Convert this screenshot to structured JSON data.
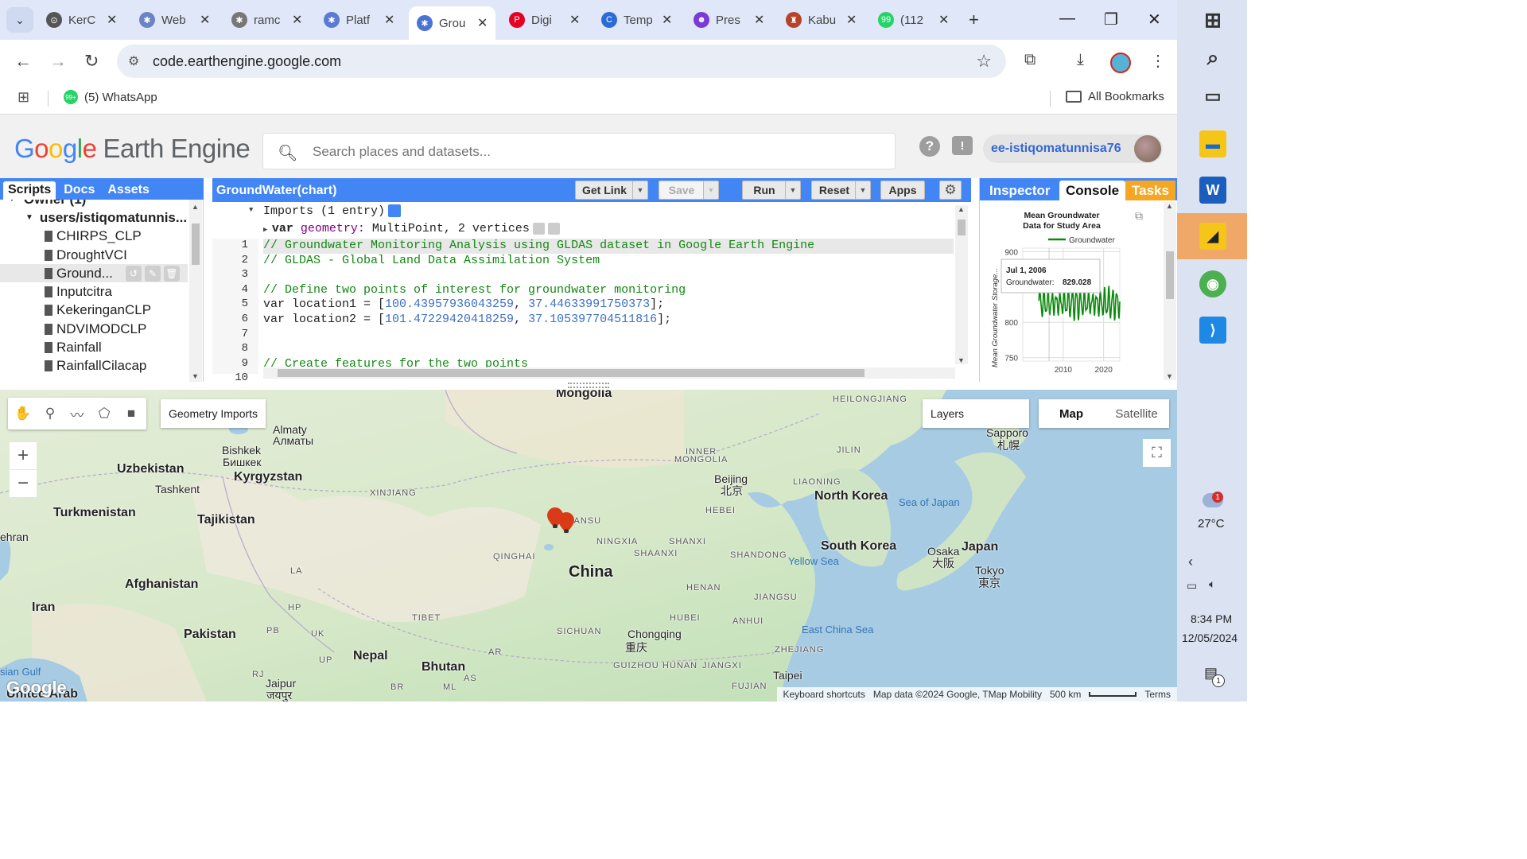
{
  "browser": {
    "tabs": [
      {
        "title": "KerC",
        "color": "#555555",
        "glyph": "⊙"
      },
      {
        "title": "Web",
        "color": "#6a84c4",
        "glyph": "✱"
      },
      {
        "title": "ramc",
        "color": "#777777",
        "glyph": "✱"
      },
      {
        "title": "Platf",
        "color": "#5a7bd4",
        "glyph": "✱"
      },
      {
        "title": "Grou",
        "color": "#4a74d4",
        "glyph": "✱",
        "active": true
      },
      {
        "title": "Digi",
        "color": "#e60023",
        "glyph": "P"
      },
      {
        "title": "Temp",
        "color": "#2a6bd6",
        "glyph": "C"
      },
      {
        "title": "Pres",
        "color": "#7a3ad6",
        "glyph": "☻"
      },
      {
        "title": "Kabu",
        "color": "#b5432a",
        "glyph": "♜"
      },
      {
        "title": "(112",
        "color": "#25d366",
        "glyph": "99"
      }
    ],
    "url": "code.earthengine.google.com",
    "bookmarks": {
      "whatsapp": "(5) WhatsApp",
      "whatsapp_badge": "99+",
      "all": "All Bookmarks"
    }
  },
  "gee": {
    "logo_google": [
      "G",
      "o",
      "o",
      "g",
      "l",
      "e"
    ],
    "logo_product": "Earth Engine",
    "search_placeholder": "Search places and datasets...",
    "username": "ee-istiqomatunnisa76",
    "left_tabs": [
      "Scripts",
      "Docs",
      "Assets"
    ],
    "tree": {
      "owner": "Owner (1)",
      "repo": "users/istiqomatunnis...",
      "files": [
        "CHIRPS_CLP",
        "DroughtVCI",
        "Ground...",
        "Inputcitra",
        "KekeringanCLP",
        "NDVIMODCLP",
        "Rainfall",
        "RainfallCilacap"
      ]
    },
    "editor": {
      "title": "GroundWater(chart)",
      "buttons": {
        "get_link": "Get Link",
        "save": "Save",
        "run": "Run",
        "reset": "Reset",
        "apps": "Apps"
      },
      "imports_header": "Imports (1 entry)",
      "imports_var_kw": "var",
      "imports_var_name": "geometry:",
      "imports_var_value": "MultiPoint, 2 vertices",
      "line_numbers": [
        "1",
        "2",
        "3",
        "4",
        "5",
        "6",
        "7",
        "8",
        "9",
        "10"
      ],
      "lines": [
        {
          "parts": [
            {
              "t": "// Groundwater Monitoring Analysis using GLDAS dataset in Google Earth Engine",
              "c": "cm"
            }
          ]
        },
        {
          "parts": [
            {
              "t": "// GLDAS - Global Land Data Assimilation System",
              "c": "cm"
            }
          ]
        },
        {
          "parts": [
            {
              "t": "",
              "c": ""
            }
          ]
        },
        {
          "parts": [
            {
              "t": "// Define two points of interest for groundwater monitoring",
              "c": "cm"
            }
          ]
        },
        {
          "parts": [
            {
              "t": "var location1 = [",
              "c": ""
            },
            {
              "t": "100.43957936043259",
              "c": "num"
            },
            {
              "t": ", ",
              "c": ""
            },
            {
              "t": "37.44633991750373",
              "c": "num"
            },
            {
              "t": "];",
              "c": ""
            }
          ]
        },
        {
          "parts": [
            {
              "t": "var location2 = [",
              "c": ""
            },
            {
              "t": "101.47229420418259",
              "c": "num"
            },
            {
              "t": ", ",
              "c": ""
            },
            {
              "t": "37.105397704511816",
              "c": "num"
            },
            {
              "t": "];",
              "c": ""
            }
          ]
        },
        {
          "parts": [
            {
              "t": "",
              "c": ""
            }
          ]
        },
        {
          "parts": [
            {
              "t": "",
              "c": ""
            }
          ]
        },
        {
          "parts": [
            {
              "t": "// Create features for the two points",
              "c": "cm"
            }
          ]
        },
        {
          "parts": [
            {
              "t": "",
              "c": ""
            }
          ]
        }
      ]
    },
    "right_tabs": [
      "Inspector",
      "Console",
      "Tasks"
    ],
    "map": {
      "geometry_imports": "Geometry Imports",
      "layers": "Layers",
      "map_types": [
        "Map",
        "Satellite"
      ],
      "attribution": [
        "Keyboard shortcuts",
        "Map data ©2024 Google, TMap Mobility",
        "500 km",
        "Terms"
      ],
      "watermark": "Google",
      "labels": [
        {
          "t": "Mongolia",
          "k": "country"
        },
        {
          "t": "HEILONGJIANG",
          "k": "prov"
        },
        {
          "t": "Almaty",
          "k": "city"
        },
        {
          "t": "Алматы",
          "k": "city"
        },
        {
          "t": "Bishkek",
          "k": "city"
        },
        {
          "t": "Бишкек",
          "k": "city"
        },
        {
          "t": "Uzbekistan",
          "k": "country"
        },
        {
          "t": "Kyrgyzstan",
          "k": "country"
        },
        {
          "t": "Tashkent",
          "k": "city"
        },
        {
          "t": "INNER",
          "k": "prov"
        },
        {
          "t": "MONGOLIA",
          "k": "prov"
        },
        {
          "t": "JILIN",
          "k": "prov"
        },
        {
          "t": "Sapporo",
          "k": "city"
        },
        {
          "t": "札幌",
          "k": "city"
        },
        {
          "t": "XINJIANG",
          "k": "prov"
        },
        {
          "t": "Beijing",
          "k": "city"
        },
        {
          "t": "北京",
          "k": "city"
        },
        {
          "t": "LIAONING",
          "k": "prov"
        },
        {
          "t": "Turkmenistan",
          "k": "country"
        },
        {
          "t": "Tajikistan",
          "k": "country"
        },
        {
          "t": "North Korea",
          "k": "country"
        },
        {
          "t": "Sea of Japan",
          "k": "sea"
        },
        {
          "t": "HEBEI",
          "k": "prov"
        },
        {
          "t": "GANSU",
          "k": "prov"
        },
        {
          "t": "NINGXIA",
          "k": "prov"
        },
        {
          "t": "SHANXI",
          "k": "prov"
        },
        {
          "t": "ehran",
          "k": "city"
        },
        {
          "t": "QINGHAI",
          "k": "prov"
        },
        {
          "t": "SHAANXI",
          "k": "prov"
        },
        {
          "t": "SHANDONG",
          "k": "prov"
        },
        {
          "t": "South Korea",
          "k": "country"
        },
        {
          "t": "Osaka",
          "k": "city"
        },
        {
          "t": "大阪",
          "k": "city"
        },
        {
          "t": "Japan",
          "k": "country"
        },
        {
          "t": "Tokyo",
          "k": "city"
        },
        {
          "t": "東京",
          "k": "city"
        },
        {
          "t": "Yellow Sea",
          "k": "sea"
        },
        {
          "t": "China",
          "k": "big"
        },
        {
          "t": "Afghanistan",
          "k": "country"
        },
        {
          "t": "HENAN",
          "k": "prov"
        },
        {
          "t": "JIANGSU",
          "k": "prov"
        },
        {
          "t": "Iran",
          "k": "country"
        },
        {
          "t": "TIBET",
          "k": "prov"
        },
        {
          "t": "HUBEI",
          "k": "prov"
        },
        {
          "t": "ANHUI",
          "k": "prov"
        },
        {
          "t": "Pakistan",
          "k": "country"
        },
        {
          "t": "SICHUAN",
          "k": "prov"
        },
        {
          "t": "Chongqing",
          "k": "city"
        },
        {
          "t": "重庆",
          "k": "city"
        },
        {
          "t": "East China Sea",
          "k": "sea"
        },
        {
          "t": "ZHEJIANG",
          "k": "prov"
        },
        {
          "t": "Nepal",
          "k": "country"
        },
        {
          "t": "Bhutan",
          "k": "country"
        },
        {
          "t": "GUIZHOU",
          "k": "prov"
        },
        {
          "t": "HUNAN",
          "k": "prov"
        },
        {
          "t": "JIANGXI",
          "k": "prov"
        },
        {
          "t": "Taipei",
          "k": "city"
        },
        {
          "t": "Jaipur",
          "k": "city"
        },
        {
          "t": "जयपुर",
          "k": "city"
        },
        {
          "t": "sian Gulf",
          "k": "sea"
        },
        {
          "t": "United Arab",
          "k": "country"
        },
        {
          "t": "FUJIAN",
          "k": "prov"
        },
        {
          "t": "HP",
          "k": "prov"
        },
        {
          "t": "LA",
          "k": "prov"
        },
        {
          "t": "PB",
          "k": "prov"
        },
        {
          "t": "UK",
          "k": "prov"
        },
        {
          "t": "UP",
          "k": "prov"
        },
        {
          "t": "RJ",
          "k": "prov"
        },
        {
          "t": "BR",
          "k": "prov"
        },
        {
          "t": "ML",
          "k": "prov"
        },
        {
          "t": "AS",
          "k": "prov"
        },
        {
          "t": "AR",
          "k": "prov"
        }
      ]
    }
  },
  "chart_data": {
    "type": "line",
    "title": "Mean Groundwater\nData for Study Area",
    "ylabel": "Mean Groundwater Storage...",
    "series": [
      {
        "name": "Groundwater",
        "color": "#0a8a0a"
      }
    ],
    "ylim": [
      745,
      905
    ],
    "yticks": [
      750,
      800,
      900
    ],
    "xticks": [
      2010,
      2020
    ],
    "xlim": [
      2000,
      2024
    ],
    "tooltip": {
      "date": "Jul 1, 2006",
      "label": "Groundwater:",
      "value": "829.028"
    }
  },
  "os": {
    "temperature": "27°C",
    "weather_badge": "1",
    "time": "8:34 PM",
    "date": "12/05/2024",
    "notif_badge": "1"
  }
}
